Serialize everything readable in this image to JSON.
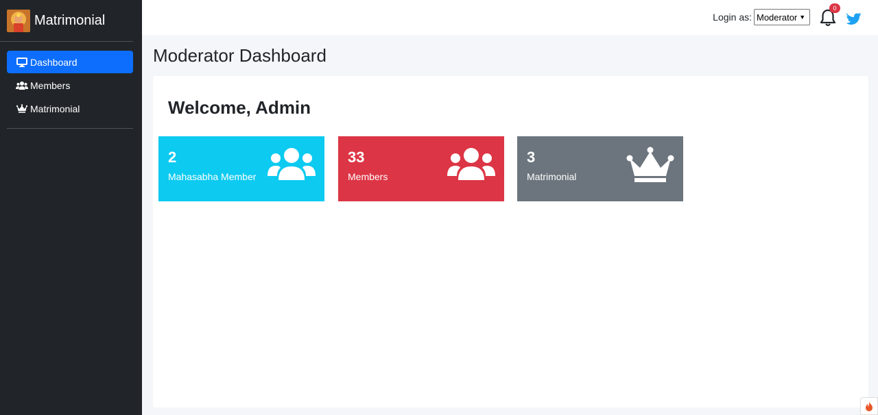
{
  "brand": {
    "name": "Matrimonial",
    "logo_icon": "deity-logo-icon"
  },
  "sidebar": {
    "items": [
      {
        "label": "Dashboard",
        "icon": "desktop-icon",
        "active": true
      },
      {
        "label": "Members",
        "icon": "users-icon",
        "active": false
      },
      {
        "label": "Matrimonial",
        "icon": "crown-icon",
        "active": false
      }
    ]
  },
  "topbar": {
    "login_label": "Login as:",
    "login_value": "Moderator",
    "notification_count": "0"
  },
  "main": {
    "page_title": "Moderator Dashboard",
    "welcome": "Welcome, Admin",
    "stats": [
      {
        "value": "2",
        "label": "Mahasabha Member",
        "icon": "users-icon",
        "color": "#0dcaf0"
      },
      {
        "value": "33",
        "label": "Members",
        "icon": "users-icon",
        "color": "#dc3545"
      },
      {
        "value": "3",
        "label": "Matrimonial",
        "icon": "crown-icon",
        "color": "#6c757d"
      }
    ]
  },
  "colors": {
    "sidebar": "#212529",
    "accent": "#0d6efd",
    "background": "#f4f6f9",
    "twitter": "#1da1f2"
  }
}
